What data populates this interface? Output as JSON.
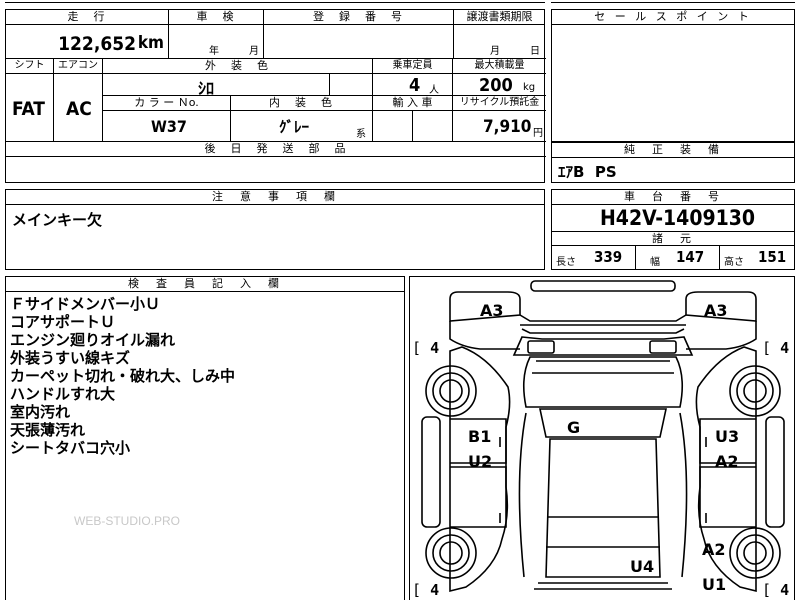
{
  "top_fragment": "",
  "info": {
    "mileage_label": "走　行",
    "mileage_value": "122,652",
    "mileage_unit": "km",
    "inspection_label": "車　検",
    "inspection_year_unit": "年",
    "inspection_month_unit": "月",
    "registration_label": "登　録　番　号",
    "transfer_label": "譲渡書類期限",
    "transfer_month_unit": "月",
    "transfer_day_unit": "日",
    "shift_label": "シフト",
    "shift_value": "FAT",
    "aircon_label": "エアコン",
    "aircon_value": "AC",
    "exterior_color_label": "外　装　色",
    "exterior_color_value": "ｼﾛ",
    "capacity_label": "乗車定員",
    "capacity_value": "4",
    "capacity_unit": "人",
    "max_load_label": "最大積載量",
    "max_load_value": "200",
    "max_load_unit": "kg",
    "color_no_label": "カ ラ ー Ｎo.",
    "color_no_value": "W37",
    "interior_color_label": "内　装　色",
    "interior_color_value": "ｸﾞﾚｰ",
    "interior_color_suffix": "系",
    "import_label": "輸 入 車",
    "recycle_label": "リサイクル預託金",
    "recycle_value": "7,910",
    "recycle_unit": "円",
    "later_parts_label": "後　日　発　送　部　品"
  },
  "sales_point": {
    "label": "セ ー ル ス ポ イ ン ト"
  },
  "genuine_equipment": {
    "label": "純　正　装　備",
    "value": "ｴｱB  PS"
  },
  "caution": {
    "label": "注　意　事　項　欄",
    "value": "メインキー欠"
  },
  "chassis": {
    "label": "車　台　番　号",
    "value": "H42V-1409130",
    "spec_label": "諸　元",
    "length_label": "長さ",
    "length_value": "339",
    "width_label": "幅",
    "width_value": "147",
    "height_label": "高さ",
    "height_value": "151"
  },
  "inspector": {
    "label": "検　査　員　記　入　欄",
    "notes": [
      "Ｆサイドメンバー小Ｕ",
      "コアサポートＵ",
      "エンジン廻りオイル漏れ",
      "外装うすい線キズ",
      "カーペット切れ・破れ大、しみ中",
      "ハンドルすれ大",
      "室内汚れ",
      "天張薄汚れ",
      "シートタバコ穴小"
    ]
  },
  "watermark": "WEB-STUDIO.PRO",
  "diagram": {
    "marks": {
      "front_left": "A3",
      "front_right": "A3",
      "roof": "G",
      "left_front_door_upper": "B1",
      "left_front_door_lower": "U2",
      "right_front_door_upper": "U3",
      "right_front_door_lower": "A2",
      "right_rear_upper": "A2",
      "right_rear_lower": "U1",
      "rear_center": "U4"
    },
    "tires": {
      "front_left": "4",
      "front_right": "4",
      "rear_left": "4",
      "rear_right": "4"
    }
  }
}
